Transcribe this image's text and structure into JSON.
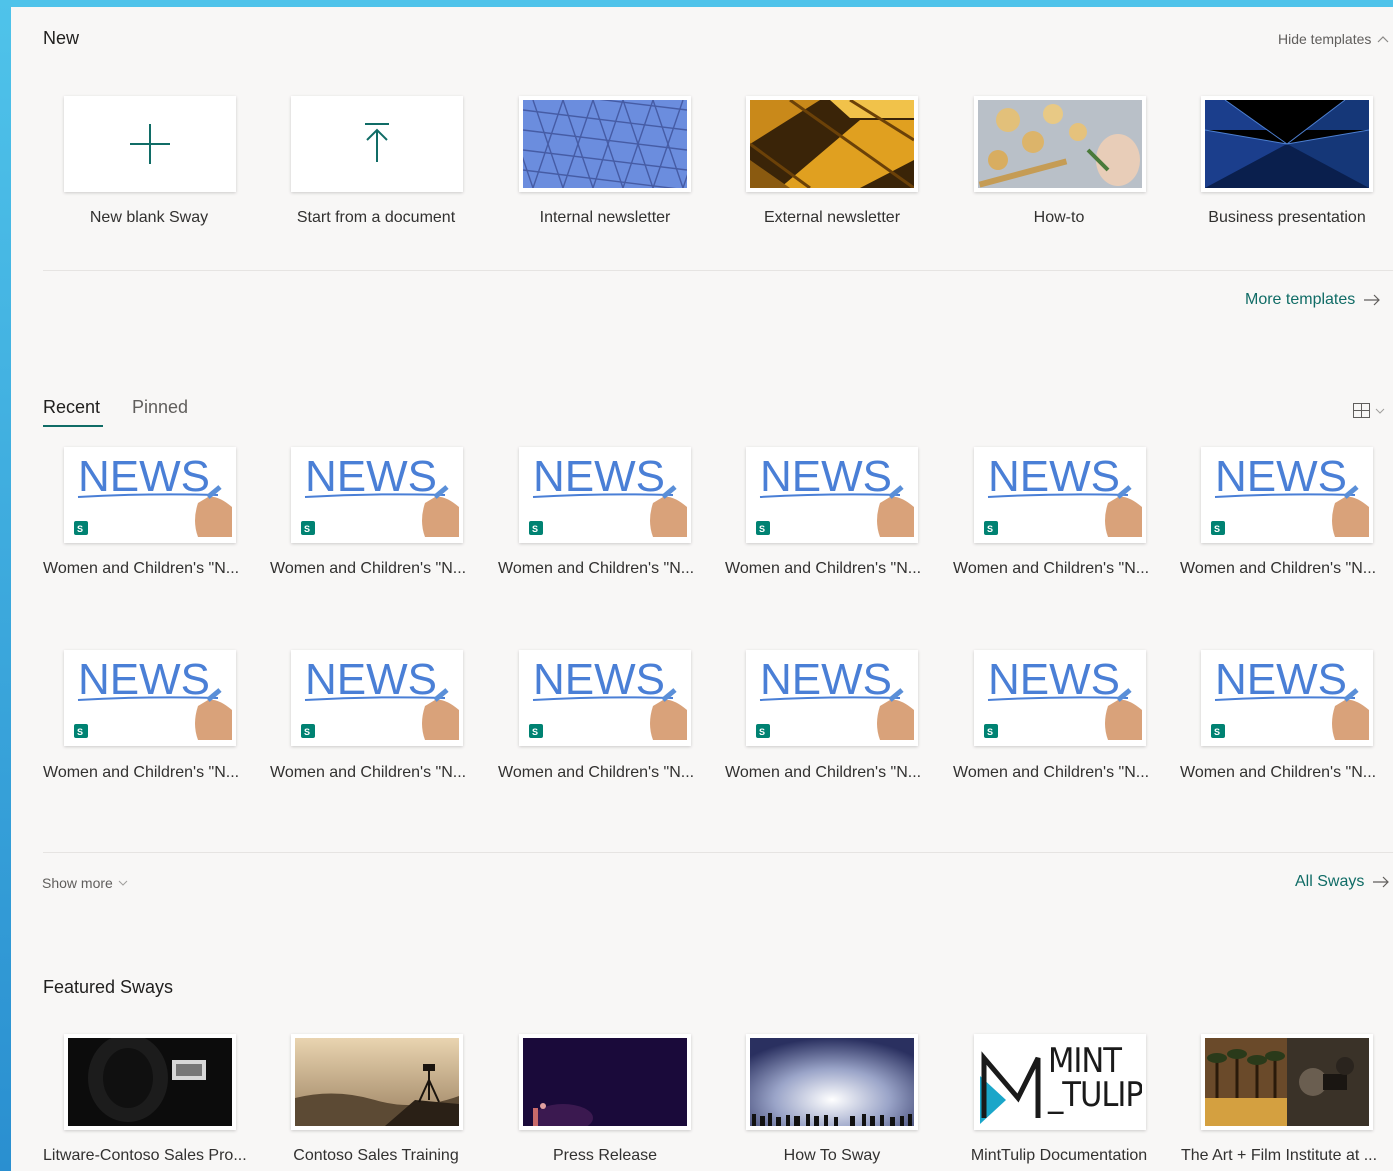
{
  "new_section": {
    "title": "New",
    "hide_templates": "Hide templates",
    "more_templates": "More templates",
    "templates": [
      {
        "label": "New blank Sway",
        "icon": "plus-icon"
      },
      {
        "label": "Start from a document",
        "icon": "upload-icon"
      },
      {
        "label": "Internal newsletter",
        "icon": "glass-building-thumbnail"
      },
      {
        "label": "External newsletter",
        "icon": "gold-facade-thumbnail"
      },
      {
        "label": "How-to",
        "icon": "pasta-cooking-thumbnail"
      },
      {
        "label": "Business presentation",
        "icon": "skyscrapers-thumbnail"
      }
    ]
  },
  "recent_section": {
    "tabs": [
      "Recent",
      "Pinned"
    ],
    "active_tab": "Recent",
    "items": [
      {
        "label": "Women and Children's \"N..."
      },
      {
        "label": "Women and Children's \"N..."
      },
      {
        "label": "Women and Children's \"N..."
      },
      {
        "label": "Women and Children's \"N..."
      },
      {
        "label": "Women and Children's \"N..."
      },
      {
        "label": "Women and Children's \"N..."
      },
      {
        "label": "Women and Children's \"N..."
      },
      {
        "label": "Women and Children's \"N..."
      },
      {
        "label": "Women and Children's \"N..."
      },
      {
        "label": "Women and Children's \"N..."
      },
      {
        "label": "Women and Children's \"N..."
      },
      {
        "label": "Women and Children's \"N..."
      }
    ],
    "thumb_text": "NEWS",
    "show_more": "Show more",
    "all_sways": "All Sways"
  },
  "featured_section": {
    "title": "Featured Sways",
    "items": [
      {
        "label": "Litware-Contoso Sales Pro..."
      },
      {
        "label": "Contoso Sales Training"
      },
      {
        "label": "Press Release"
      },
      {
        "label": "How To Sway"
      },
      {
        "label": "MintTulip Documentation",
        "logo_line1": "MINT",
        "logo_line2": "_TULIP"
      },
      {
        "label": "The Art + Film Institute at ..."
      }
    ]
  },
  "colors": {
    "accent": "#106c66",
    "news_blue": "#4a7fd6",
    "sway_green": "#008272"
  }
}
